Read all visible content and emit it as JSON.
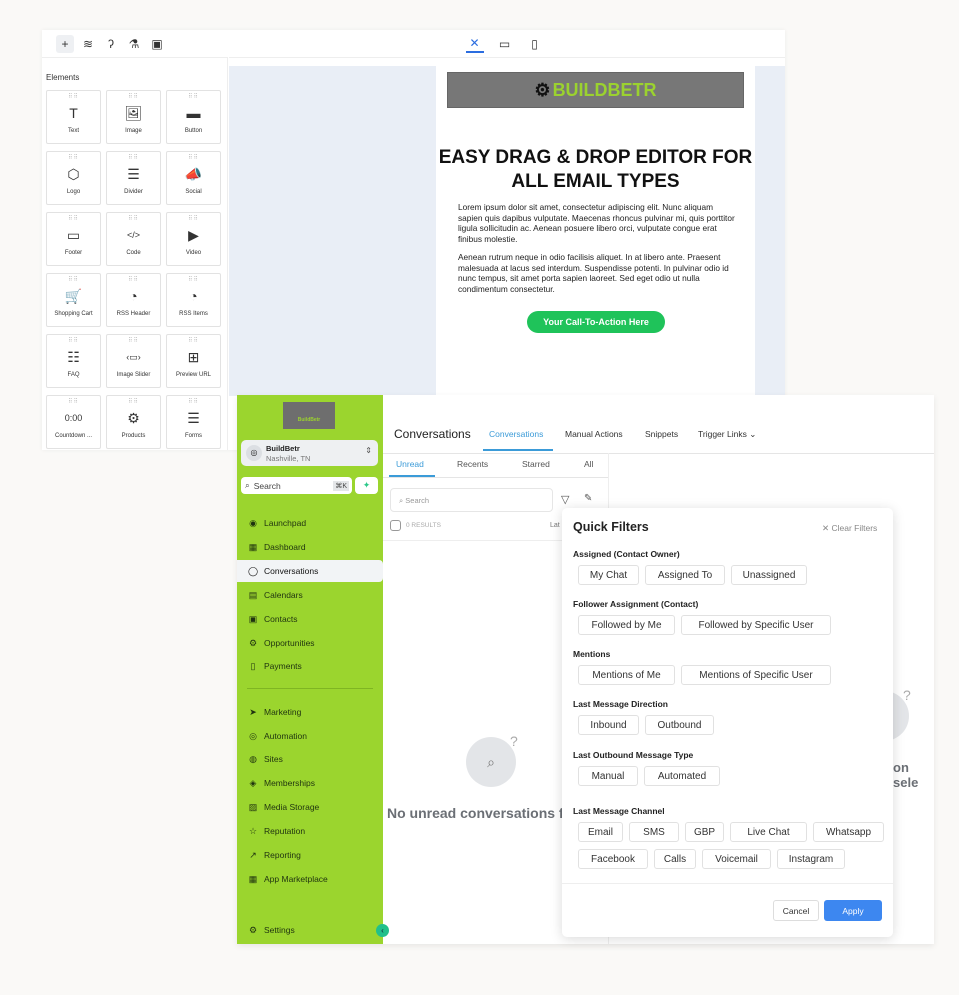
{
  "editor": {
    "toolbar_icons": [
      "plus-icon",
      "layers-icon",
      "paint-roller-icon",
      "flask-icon",
      "save-icon"
    ],
    "view_icons": [
      "tools-icon",
      "desktop-icon",
      "mobile-icon"
    ],
    "elements_title": "Elements",
    "elements": [
      {
        "label": "Text",
        "icon": "T"
      },
      {
        "label": "Image",
        "icon": "🖼"
      },
      {
        "label": "Button",
        "icon": "▬"
      },
      {
        "label": "Logo",
        "icon": "⬡"
      },
      {
        "label": "Divider",
        "icon": "☰"
      },
      {
        "label": "Social",
        "icon": "📣"
      },
      {
        "label": "Footer",
        "icon": "▭"
      },
      {
        "label": "Code",
        "icon": "</>"
      },
      {
        "label": "Video",
        "icon": "▶"
      },
      {
        "label": "Shopping Cart",
        "icon": "🛒"
      },
      {
        "label": "RSS Header",
        "icon": "◔"
      },
      {
        "label": "RSS Items",
        "icon": "◔"
      },
      {
        "label": "FAQ",
        "icon": "☷"
      },
      {
        "label": "Image Slider",
        "icon": "‹▭›"
      },
      {
        "label": "Preview URL",
        "icon": "⊞"
      },
      {
        "label": "Countdown ...",
        "icon": "0:00"
      },
      {
        "label": "Products",
        "icon": "⚙"
      },
      {
        "label": "Forms",
        "icon": "☰"
      }
    ],
    "email": {
      "brand": "BUILDBETR",
      "headline": "EASY DRAG & DROP EDITOR FOR ALL EMAIL TYPES",
      "para1": "Lorem ipsum dolor sit amet, consectetur adipiscing elit. Nunc aliquam sapien quis dapibus vulputate. Maecenas rhoncus pulvinar mi, quis porttitor ligula sollicitudin ac. Aenean posuere libero orci, vulputate congue erat finibus molestie.",
      "para2": "Aenean rutrum neque in odio facilisis aliquet. In at libero ante. Praesent malesuada at lacus sed interdum. Suspendisse potenti. In pulvinar odio id nunc tempus, sit amet porta sapien laoreet. Sed eget odio ut nulla condimentum consectetur.",
      "cta": "Your Call-To-Action Here"
    }
  },
  "conversations": {
    "sidebar": {
      "logo_text": "BuildBetr",
      "account_name": "BuildBetr",
      "account_location": "Nashville, TN",
      "search_label": "Search",
      "search_shortcut": "⌘K",
      "nav": [
        {
          "label": "Launchpad",
          "icon": "◉"
        },
        {
          "label": "Dashboard",
          "icon": "▦"
        },
        {
          "label": "Conversations",
          "icon": "◯",
          "active": true
        },
        {
          "label": "Calendars",
          "icon": "▤"
        },
        {
          "label": "Contacts",
          "icon": "▣"
        },
        {
          "label": "Opportunities",
          "icon": "⚙"
        },
        {
          "label": "Payments",
          "icon": "▯"
        },
        {
          "label": "Marketing",
          "icon": "➤"
        },
        {
          "label": "Automation",
          "icon": "◎"
        },
        {
          "label": "Sites",
          "icon": "◍"
        },
        {
          "label": "Memberships",
          "icon": "◈"
        },
        {
          "label": "Media Storage",
          "icon": "▨"
        },
        {
          "label": "Reputation",
          "icon": "☆"
        },
        {
          "label": "Reporting",
          "icon": "↗"
        },
        {
          "label": "App Marketplace",
          "icon": "▦"
        }
      ],
      "settings": "Settings"
    },
    "title": "Conversations",
    "tabs": [
      "Conversations",
      "Manual Actions",
      "Snippets",
      "Trigger Links"
    ],
    "subtabs": [
      "Unread",
      "Recents",
      "Starred",
      "All"
    ],
    "search_placeholder": "Search",
    "results": "0 RESULTS",
    "sort_label": "Lat",
    "empty_text": "No unread conversations f",
    "right_empty_text": "on sele",
    "accent": "#3b9bd8",
    "sidebar_color": "#9bd52e",
    "quick_filters": {
      "title": "Quick Filters",
      "clear": "Clear Filters",
      "sections": [
        {
          "title": "Assigned (Contact Owner)",
          "chips": [
            "My Chat",
            "Assigned To",
            "Unassigned"
          ]
        },
        {
          "title": "Follower Assignment (Contact)",
          "chips": [
            "Followed by Me",
            "Followed by Specific User"
          ]
        },
        {
          "title": "Mentions",
          "chips": [
            "Mentions of Me",
            "Mentions of Specific User"
          ]
        },
        {
          "title": "Last Message Direction",
          "chips": [
            "Inbound",
            "Outbound"
          ]
        },
        {
          "title": "Last Outbound Message Type",
          "chips": [
            "Manual",
            "Automated"
          ]
        },
        {
          "title": "Last Message Channel",
          "chips": [
            "Email",
            "SMS",
            "GBP",
            "Live Chat",
            "Whatsapp",
            "Facebook",
            "Calls",
            "Voicemail",
            "Instagram"
          ]
        }
      ],
      "cancel": "Cancel",
      "apply": "Apply"
    }
  }
}
